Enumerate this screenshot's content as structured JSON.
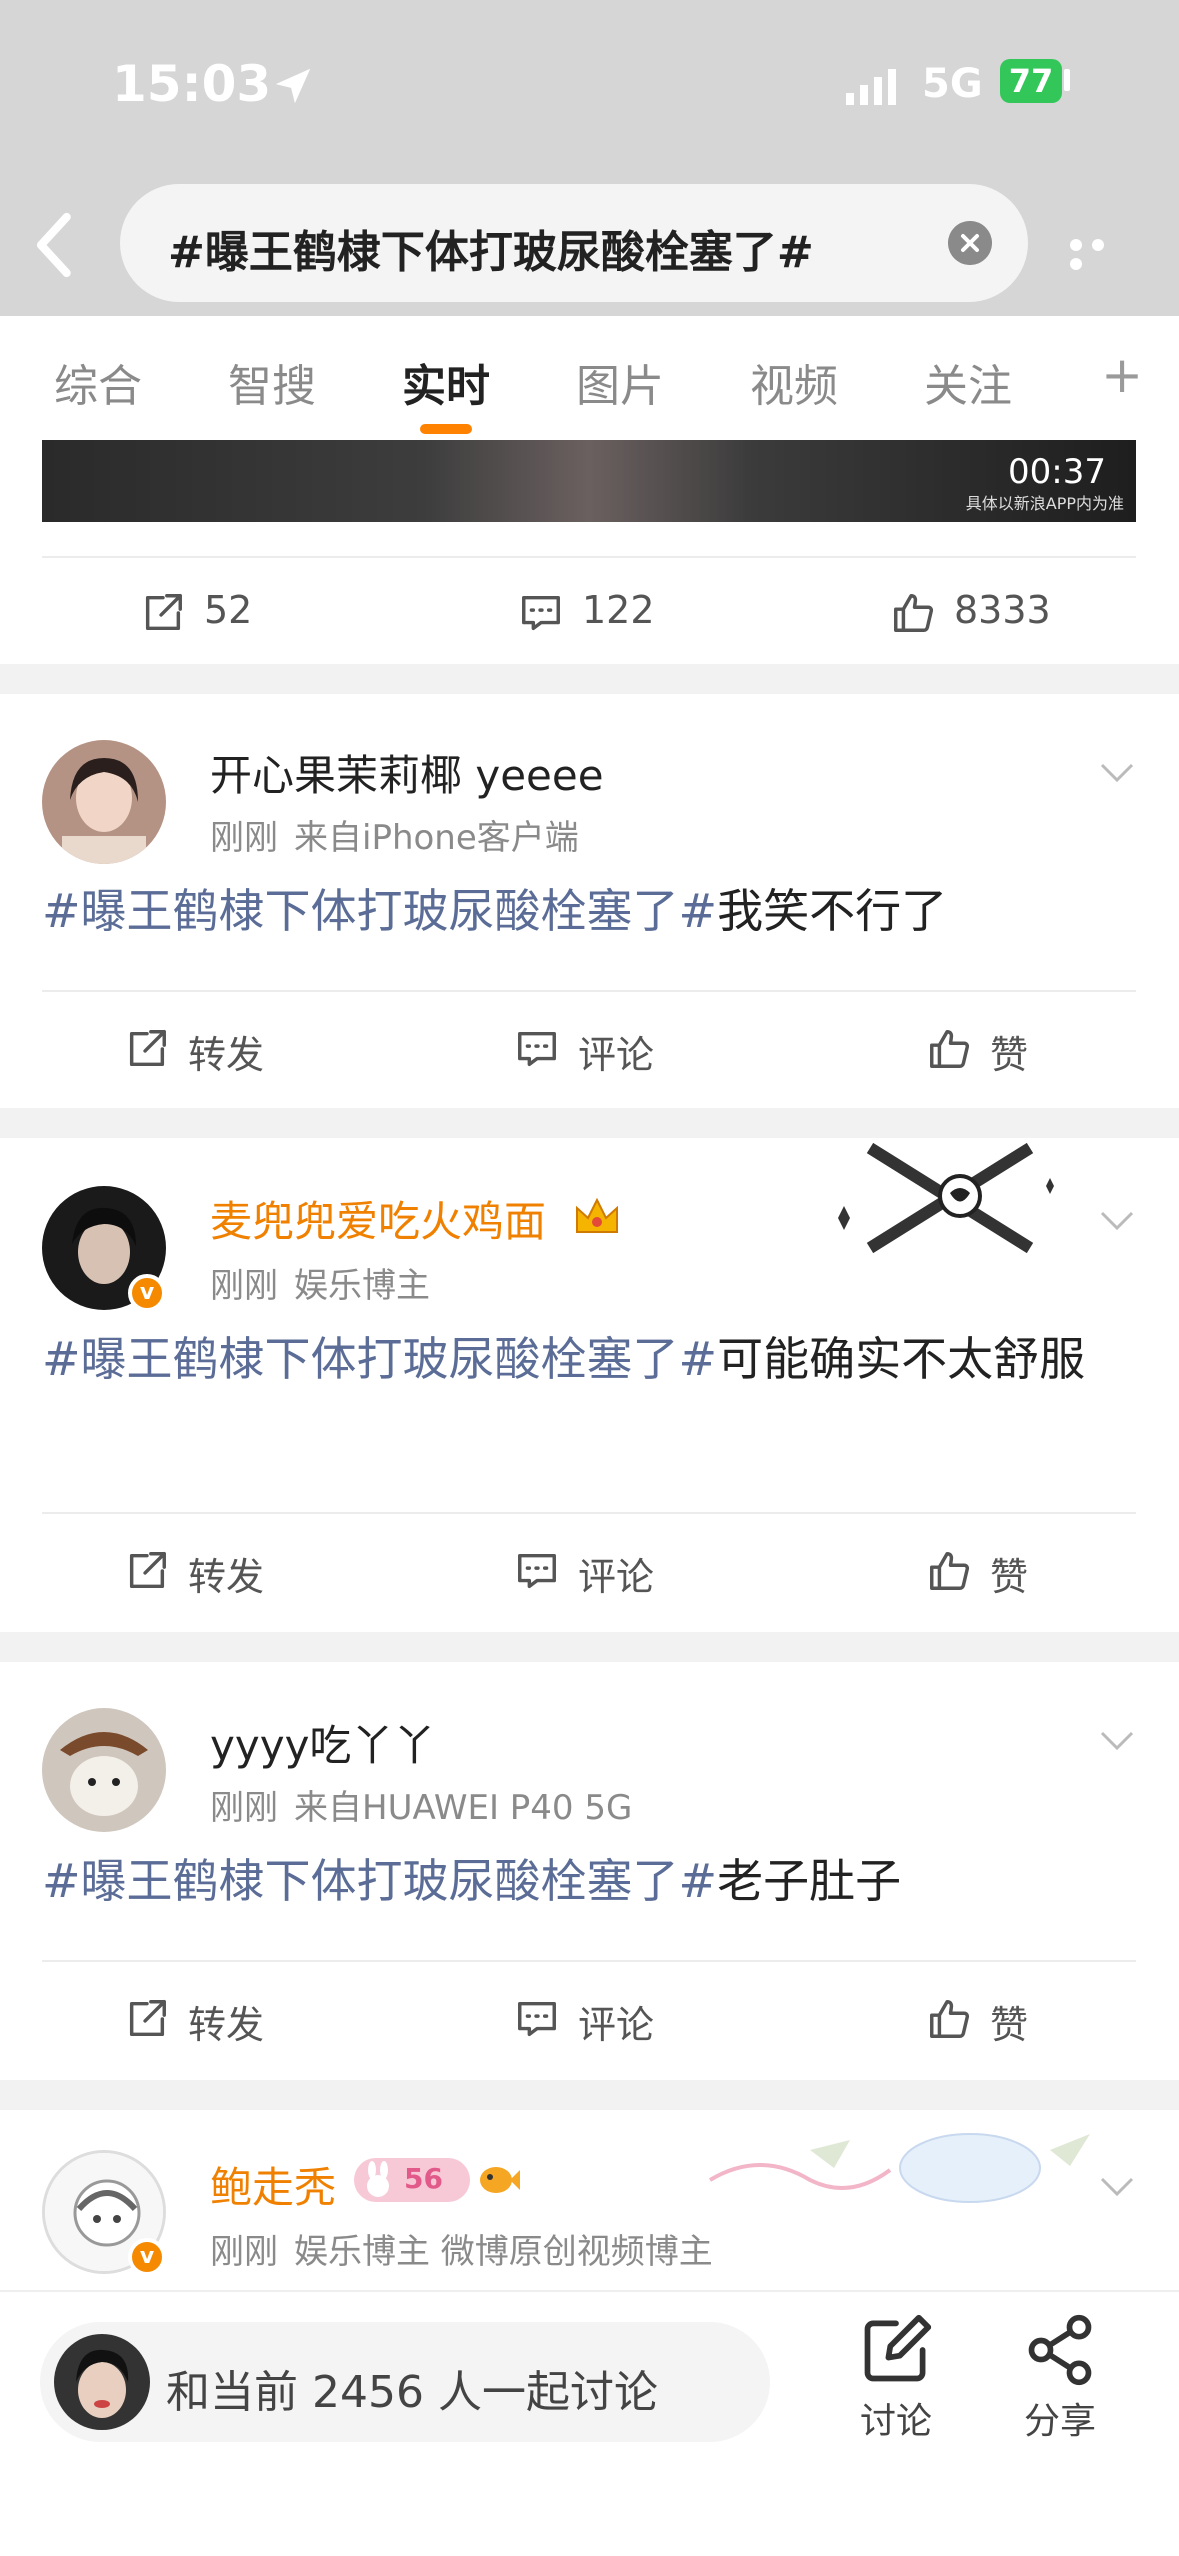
{
  "status_bar": {
    "time": "15:03",
    "network": "5G",
    "battery": "77"
  },
  "header": {
    "search_text": "#曝王鹤棣下体打玻尿酸栓塞了#"
  },
  "tabs": [
    {
      "label": "综合"
    },
    {
      "label": "智搜"
    },
    {
      "label": "实时"
    },
    {
      "label": "图片"
    },
    {
      "label": "视频"
    },
    {
      "label": "关注"
    }
  ],
  "tabs_plus": "+",
  "video_post": {
    "duration": "00:37",
    "watermark": "具体以新浪APP内为准",
    "repost_count": "52",
    "comment_count": "122",
    "like_count": "8333"
  },
  "actions": {
    "repost": "转发",
    "comment": "评论",
    "like": "赞"
  },
  "posts": [
    {
      "user": "开心果茉莉椰 yeeee",
      "time": "刚刚",
      "source": "来自iPhone客户端",
      "topic": "#曝王鹤棣下体打玻尿酸栓塞了#",
      "text": "我笑不行了"
    },
    {
      "user": "麦兜兜爱吃火鸡面",
      "time": "刚刚",
      "source": "娱乐博主",
      "topic": "#曝王鹤棣下体打玻尿酸栓塞了#",
      "text": "可能确实不太舒服"
    },
    {
      "user": "yyyy吃丫丫",
      "time": "刚刚",
      "source": "来自HUAWEI P40 5G",
      "topic": "#曝王鹤棣下体打玻尿酸栓塞了#",
      "text": "老子肚子"
    },
    {
      "user": "鲍走秃",
      "time": "刚刚",
      "source": "娱乐博主 微博原创视频博主",
      "level_badge": "56"
    }
  ],
  "bottom_bar": {
    "discussion_text": "和当前 2456 人一起讨论",
    "discuss_label": "讨论",
    "share_label": "分享"
  },
  "colors": {
    "accent": "#ff8200",
    "topic": "#5b6d97",
    "vip_name": "#f08000"
  }
}
